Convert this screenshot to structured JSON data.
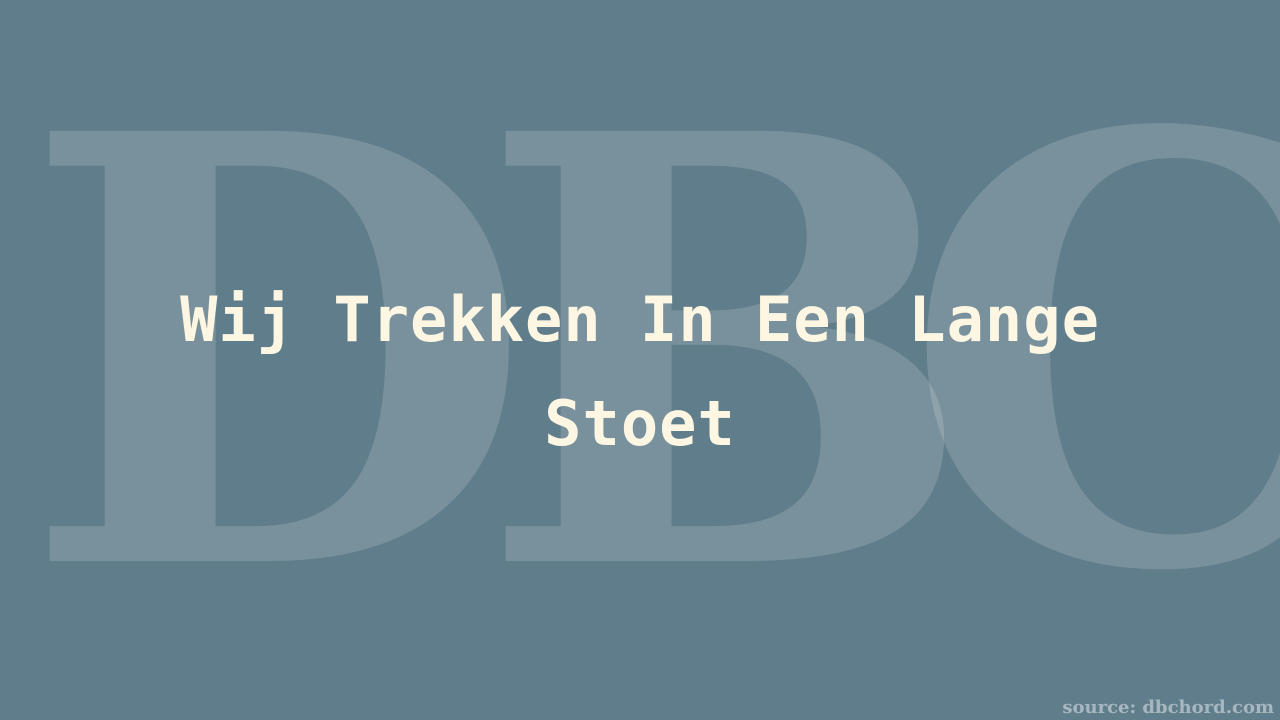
{
  "watermark": {
    "letters": [
      "D",
      "B",
      "C"
    ]
  },
  "title": "Wij Trekken In Een Lange Stoet",
  "source": "source: dbchord.com",
  "colors": {
    "background": "#607d8b",
    "title_text": "#fdf6e3",
    "watermark": "rgba(255,255,255,0.16)"
  }
}
